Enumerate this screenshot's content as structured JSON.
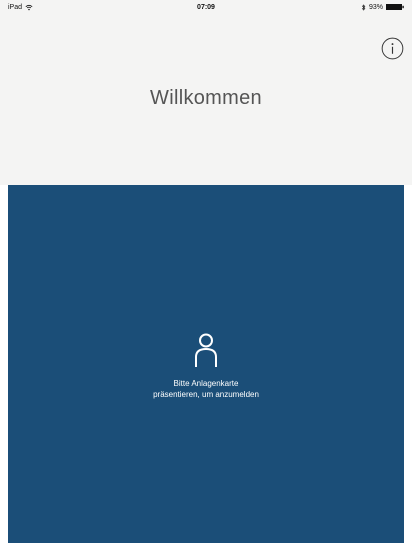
{
  "status_bar": {
    "device": "iPad",
    "time": "07:09",
    "battery_percent": "93%"
  },
  "header": {
    "title": "Willkommen",
    "info_icon": "info-icon"
  },
  "login": {
    "icon": "person-icon",
    "prompt_line1": "Bitte Anlagenkarte",
    "prompt_line2": "präsentieren, um anzumelden"
  },
  "colors": {
    "header_bg": "#f4f4f3",
    "panel_bg": "#1b4e78",
    "title_text": "#555555",
    "prompt_text": "#ffffff"
  }
}
